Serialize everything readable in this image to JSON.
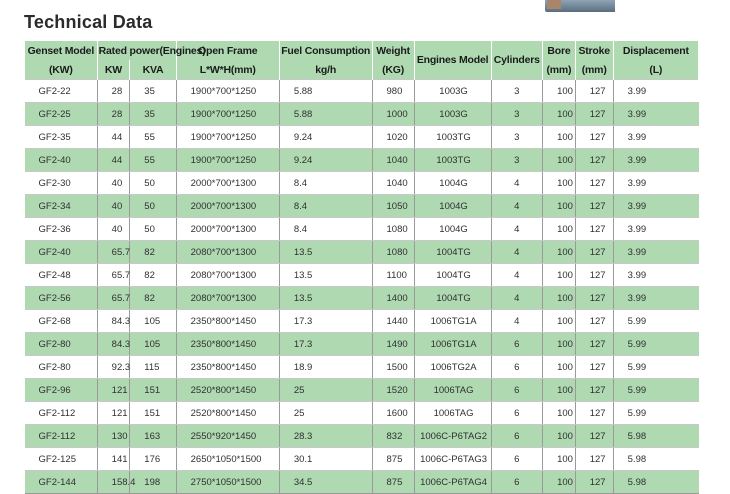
{
  "title": "Technical Data",
  "header": {
    "row1": {
      "genset_model": "Genset Model",
      "rated_power": "Rated power(Engines)",
      "open_frame": "Open Frame",
      "fuel_consumption": "Fuel Consumption",
      "weight": "Weight",
      "engines_model": "Engines Model",
      "cylinders": "Cylinders",
      "bore": "Bore",
      "stroke": "Stroke",
      "displacement": "Displacement"
    },
    "row2": {
      "genset_model_unit": "(KW)",
      "kw": "KW",
      "kva": "KVA",
      "open_frame_unit": "L*W*H(mm)",
      "fuel_unit": "kg/h",
      "weight_unit": "(KG)",
      "bore_unit": "(mm)",
      "stroke_unit": "(mm)",
      "displacement_unit": "(L)"
    }
  },
  "rows": [
    {
      "model": "GF2-22",
      "kw": "28",
      "kva": "35",
      "frame": "1900*700*1250",
      "fuel": "5.88",
      "weight": "980",
      "engine": "1003G",
      "cyl": "3",
      "bore": "100",
      "stroke": "127",
      "disp": "3.99"
    },
    {
      "model": "GF2-25",
      "kw": "28",
      "kva": "35",
      "frame": "1900*700*1250",
      "fuel": "5.88",
      "weight": "1000",
      "engine": "1003G",
      "cyl": "3",
      "bore": "100",
      "stroke": "127",
      "disp": "3.99"
    },
    {
      "model": "GF2-35",
      "kw": "44",
      "kva": "55",
      "frame": "1900*700*1250",
      "fuel": "9.24",
      "weight": "1020",
      "engine": "1003TG",
      "cyl": "3",
      "bore": "100",
      "stroke": "127",
      "disp": "3.99"
    },
    {
      "model": "GF2-40",
      "kw": "44",
      "kva": "55",
      "frame": "1900*700*1250",
      "fuel": "9.24",
      "weight": "1040",
      "engine": "1003TG",
      "cyl": "3",
      "bore": "100",
      "stroke": "127",
      "disp": "3.99"
    },
    {
      "model": "GF2-30",
      "kw": "40",
      "kva": "50",
      "frame": "2000*700*1300",
      "fuel": "8.4",
      "weight": "1040",
      "engine": "1004G",
      "cyl": "4",
      "bore": "100",
      "stroke": "127",
      "disp": "3.99"
    },
    {
      "model": "GF2-34",
      "kw": "40",
      "kva": "50",
      "frame": "2000*700*1300",
      "fuel": "8.4",
      "weight": "1050",
      "engine": "1004G",
      "cyl": "4",
      "bore": "100",
      "stroke": "127",
      "disp": "3.99"
    },
    {
      "model": "GF2-36",
      "kw": "40",
      "kva": "50",
      "frame": "2000*700*1300",
      "fuel": "8.4",
      "weight": "1080",
      "engine": "1004G",
      "cyl": "4",
      "bore": "100",
      "stroke": "127",
      "disp": "3.99"
    },
    {
      "model": "GF2-40",
      "kw": "65.7",
      "kva": "82",
      "frame": "2080*700*1300",
      "fuel": "13.5",
      "weight": "1080",
      "engine": "1004TG",
      "cyl": "4",
      "bore": "100",
      "stroke": "127",
      "disp": "3.99"
    },
    {
      "model": "GF2-48",
      "kw": "65.7",
      "kva": "82",
      "frame": "2080*700*1300",
      "fuel": "13.5",
      "weight": "1100",
      "engine": "1004TG",
      "cyl": "4",
      "bore": "100",
      "stroke": "127",
      "disp": "3.99"
    },
    {
      "model": "GF2-56",
      "kw": "65.7",
      "kva": "82",
      "frame": "2080*700*1300",
      "fuel": "13.5",
      "weight": "1400",
      "engine": "1004TG",
      "cyl": "4",
      "bore": "100",
      "stroke": "127",
      "disp": "3.99"
    },
    {
      "model": "GF2-68",
      "kw": "84.3",
      "kva": "105",
      "frame": "2350*800*1450",
      "fuel": "17.3",
      "weight": "1440",
      "engine": "1006TG1A",
      "cyl": "4",
      "bore": "100",
      "stroke": "127",
      "disp": "5.99"
    },
    {
      "model": "GF2-80",
      "kw": "84.3",
      "kva": "105",
      "frame": "2350*800*1450",
      "fuel": "17.3",
      "weight": "1490",
      "engine": "1006TG1A",
      "cyl": "6",
      "bore": "100",
      "stroke": "127",
      "disp": "5.99"
    },
    {
      "model": "GF2-80",
      "kw": "92.3",
      "kva": "115",
      "frame": "2350*800*1450",
      "fuel": "18.9",
      "weight": "1500",
      "engine": "1006TG2A",
      "cyl": "6",
      "bore": "100",
      "stroke": "127",
      "disp": "5.99"
    },
    {
      "model": "GF2-96",
      "kw": "121",
      "kva": "151",
      "frame": "2520*800*1450",
      "fuel": "25",
      "weight": "1520",
      "engine": "1006TAG",
      "cyl": "6",
      "bore": "100",
      "stroke": "127",
      "disp": "5.99"
    },
    {
      "model": "GF2-112",
      "kw": "121",
      "kva": "151",
      "frame": "2520*800*1450",
      "fuel": "25",
      "weight": "1600",
      "engine": "1006TAG",
      "cyl": "6",
      "bore": "100",
      "stroke": "127",
      "disp": "5.99"
    },
    {
      "model": "GF2-112",
      "kw": "130",
      "kva": "163",
      "frame": "2550*920*1450",
      "fuel": "28.3",
      "weight": "832",
      "engine": "1006C-P6TAG2",
      "cyl": "6",
      "bore": "100",
      "stroke": "127",
      "disp": "5.98"
    },
    {
      "model": "GF2-125",
      "kw": "141",
      "kva": "176",
      "frame": "2650*1050*1500",
      "fuel": "30.1",
      "weight": "875",
      "engine": "1006C-P6TAG3",
      "cyl": "6",
      "bore": "100",
      "stroke": "127",
      "disp": "5.98"
    },
    {
      "model": "GF2-144",
      "kw": "158.4",
      "kva": "198",
      "frame": "2750*1050*1500",
      "fuel": "34.5",
      "weight": "875",
      "engine": "1006C-P6TAG4",
      "cyl": "6",
      "bore": "100",
      "stroke": "127",
      "disp": "5.98"
    }
  ]
}
